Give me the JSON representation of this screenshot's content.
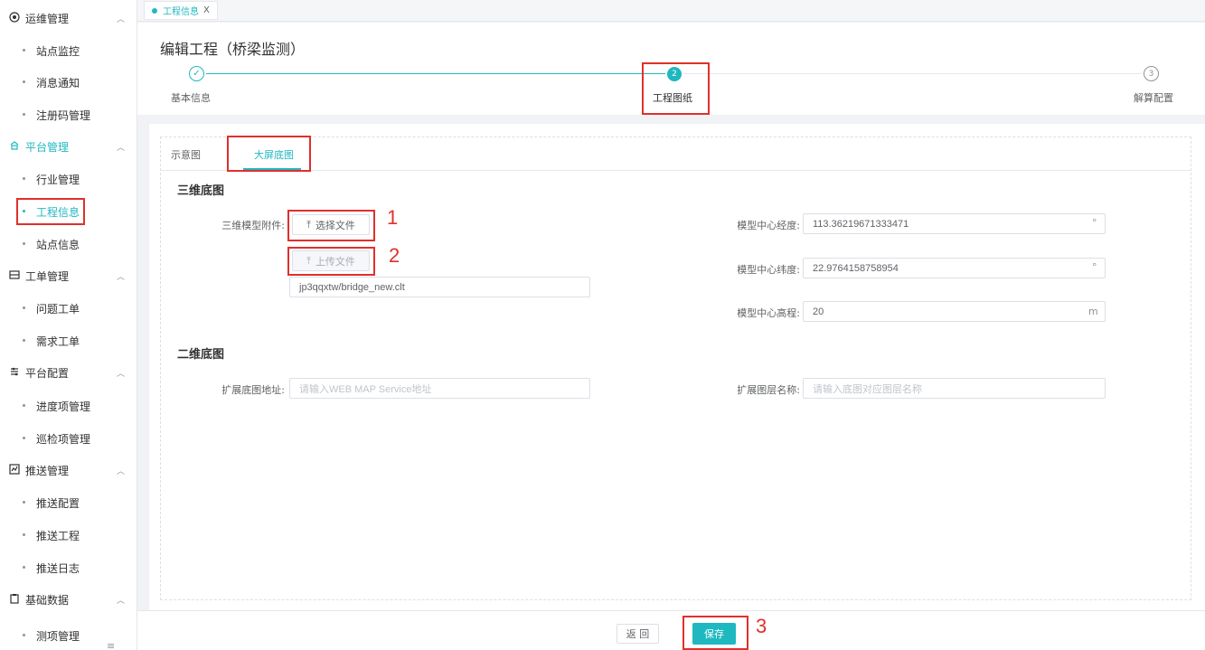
{
  "sidebar": {
    "groups": [
      {
        "label": "运维管理",
        "icon": "target-icon",
        "items": [
          "站点监控",
          "消息通知",
          "注册码管理"
        ]
      },
      {
        "label": "平台管理",
        "icon": "platform-icon",
        "items": [
          "行业管理",
          "工程信息",
          "站点信息"
        ]
      },
      {
        "label": "工单管理",
        "icon": "ticket-icon",
        "items": [
          "问题工单",
          "需求工单"
        ]
      },
      {
        "label": "平台配置",
        "icon": "config-icon",
        "items": [
          "进度项管理",
          "巡检项管理"
        ]
      },
      {
        "label": "推送管理",
        "icon": "push-icon",
        "items": [
          "推送配置",
          "推送工程",
          "推送日志"
        ]
      },
      {
        "label": "基础数据",
        "icon": "clipboard-icon",
        "items": [
          "测项管理"
        ]
      }
    ],
    "active_group": "平台管理",
    "active_item": "工程信息"
  },
  "tabstrip": {
    "tab_label": "工程信息",
    "close": "X"
  },
  "header": {
    "title": "编辑工程（桥梁监测）",
    "steps": [
      {
        "label": "基本信息",
        "status": "done",
        "marker": "✓"
      },
      {
        "label": "工程图纸",
        "status": "active",
        "marker": "2"
      },
      {
        "label": "解算配置",
        "status": "pending",
        "marker": "3"
      }
    ]
  },
  "tabs": {
    "items": [
      "示意图",
      "大屏底图"
    ],
    "active": "大屏底图"
  },
  "section_3d": {
    "title": "三维底图",
    "attachment_label": "三维模型附件:",
    "select_button": "选择文件",
    "upload_button": "上传文件",
    "file_value": "jp3qqxtw/bridge_new.clt",
    "longitude_label": "模型中心经度:",
    "longitude_value": "113.36219671333471",
    "longitude_unit": "°",
    "latitude_label": "模型中心纬度:",
    "latitude_value": "22.9764158758954",
    "latitude_unit": "°",
    "elevation_label": "模型中心高程:",
    "elevation_value": "20",
    "elevation_unit": "m"
  },
  "section_2d": {
    "title": "二维底图",
    "map_url_label": "扩展底图地址:",
    "map_url_placeholder": "请输入WEB MAP Service地址",
    "layer_name_label": "扩展图层名称:",
    "layer_name_placeholder": "请输入底图对应图层名称"
  },
  "footer": {
    "back_label": "返 回",
    "save_label": "保存"
  },
  "annotations": [
    "1",
    "2",
    "3"
  ],
  "colors": {
    "accent": "#1fb8c0",
    "annotation": "#e0302c"
  }
}
